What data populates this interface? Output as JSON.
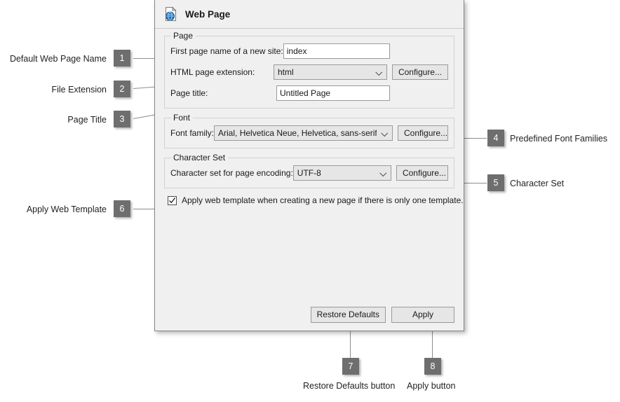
{
  "dialog": {
    "title": "Web Page",
    "title_icon": "web-page-document-globe-icon",
    "groups": {
      "page": {
        "title": "Page",
        "fields": {
          "first_page_name": {
            "label": "First page name of a new site:",
            "value": "index",
            "placeholder": ""
          },
          "html_extension": {
            "label": "HTML page extension:",
            "value": "html",
            "button": "Configure..."
          },
          "page_title": {
            "label": "Page title:",
            "value": "Untitled Page",
            "placeholder": ""
          }
        }
      },
      "font": {
        "title": "Font",
        "fields": {
          "font_family": {
            "label": "Font family:",
            "value": "Arial, Helvetica Neue, Helvetica, sans-serif",
            "button": "Configure..."
          }
        }
      },
      "charset": {
        "title": "Character Set",
        "fields": {
          "encoding": {
            "label": "Character set for page encoding:",
            "value": "UTF-8",
            "button": "Configure..."
          }
        }
      }
    },
    "checkbox": {
      "label": "Apply web template when creating a new page if there is only one template.",
      "checked": true
    },
    "footer": {
      "restore_defaults": "Restore Defaults",
      "apply": "Apply"
    }
  },
  "annotations": [
    {
      "number": "1",
      "label": "Default Web Page Name"
    },
    {
      "number": "2",
      "label": "File Extension"
    },
    {
      "number": "3",
      "label": "Page Title"
    },
    {
      "number": "4",
      "label": "Predefined Font Families"
    },
    {
      "number": "5",
      "label": "Character Set"
    },
    {
      "number": "6",
      "label": "Apply Web Template"
    },
    {
      "number": "7",
      "label": "Restore Defaults button"
    },
    {
      "number": "8",
      "label": "Apply button"
    }
  ],
  "colors": {
    "badge_bg": "#6e6e6e",
    "badge_text": "#ffffff",
    "leader_line": "#8d8d8d",
    "dialog_bg": "#f0f0f0",
    "dialog_border": "#848484",
    "input_bg": "#ffffff",
    "control_bg": "#e6e6e6",
    "text": "#1a1a1a",
    "icon_globe": "#2f78bd"
  }
}
